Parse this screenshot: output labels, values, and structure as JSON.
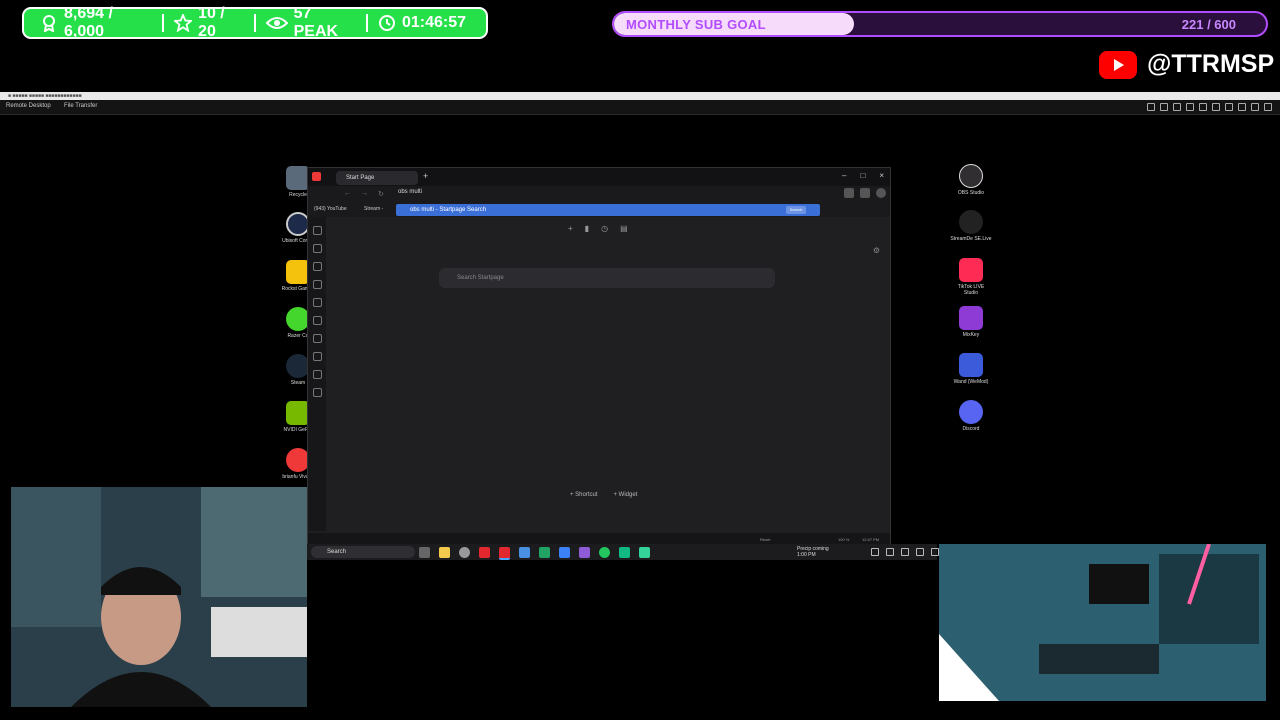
{
  "overlay": {
    "stats": {
      "followers": "8,694 / 6,000",
      "goal": "10 / 20",
      "peak": "57 PEAK",
      "timer": "01:46:57"
    },
    "sub_goal": {
      "label": "MONTHLY SUB GOAL",
      "count": "221 / 600",
      "progress": 0.368
    },
    "youtube_handle": "@TTRMSP"
  },
  "remote_desktop": {
    "tabs": [
      "Remote Desktop",
      "File Transfer"
    ]
  },
  "desktop_icons_left": [
    "Recycle",
    "Ubisoft Conne",
    "Rockst Games",
    "Razer Co",
    "Steam",
    "NVIDI GeFor",
    "brianfu Vivaldi"
  ],
  "desktop_icons_right": [
    "OBS Studio",
    "StreamDe SE.Live",
    "TikTok LIVE Studio",
    "MixKey",
    "Wand (WeMod)",
    "Discord"
  ],
  "browser": {
    "tab_title": "Start Page",
    "address_value": "obs multi",
    "suggestion": "obs multi - Startpage Search",
    "suggestion_badge": "Search",
    "bookmarks": [
      "(943) YouTube",
      "Stream -"
    ],
    "search_placeholder": "Search Startpage",
    "bottom_actions": [
      "+ Shortcut",
      "+ Widget"
    ],
    "status_zoom": "100 %",
    "status_reset": "Reset",
    "status_time": "12:47 PM"
  },
  "taskbar": {
    "search_label": "Search",
    "weather_line1": "Precip coming",
    "weather_line2": "1:00 PM"
  },
  "colors": {
    "stats_green": "#26e04a",
    "goal_purple": "#b24cff",
    "youtube_red": "#ff0000",
    "suggestion_blue": "#3b6fd8"
  }
}
